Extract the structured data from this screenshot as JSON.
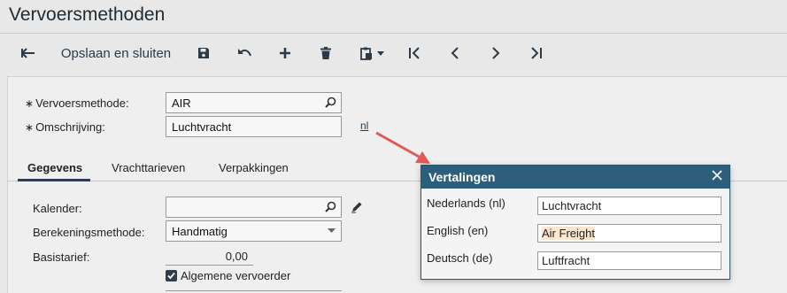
{
  "page": {
    "title": "Vervoersmethoden"
  },
  "toolbar": {
    "back_icon": "arrow-left-icon",
    "save_close_label": "Opslaan en sluiten",
    "icons": [
      "save-icon",
      "undo-icon",
      "plus-icon",
      "trash-icon",
      "clipboard-icon",
      "first-icon",
      "prev-icon",
      "next-icon",
      "last-icon"
    ]
  },
  "form": {
    "method_label": "Vervoersmethode:",
    "method_value": "AIR",
    "desc_label": "Omschrijving:",
    "desc_value": "Luchtvracht",
    "lang_link": "nl"
  },
  "tabs": [
    {
      "label": "Gegevens",
      "active": true
    },
    {
      "label": "Vrachttarieven",
      "active": false
    },
    {
      "label": "Verpakkingen",
      "active": false
    }
  ],
  "details": {
    "calendar_label": "Kalender:",
    "calendar_value": "",
    "calc_label": "Berekeningsmethode:",
    "calc_value": "Handmatig",
    "base_label": "Basistarief:",
    "base_value": "0,00",
    "general_carrier_label": "Algemene vervoerder",
    "general_carrier_checked": true
  },
  "translations": {
    "title": "Vertalingen",
    "rows": [
      {
        "label": "Nederlands (nl)",
        "value": "Luchtvracht"
      },
      {
        "label": "English (en)",
        "value": "Air Freight"
      },
      {
        "label": "Deutsch (de)",
        "value": "Luftfracht"
      }
    ]
  },
  "colors": {
    "popup_header": "#2d5e7c",
    "annotation_arrow": "#e05a55",
    "highlight": "#fde6cf"
  }
}
